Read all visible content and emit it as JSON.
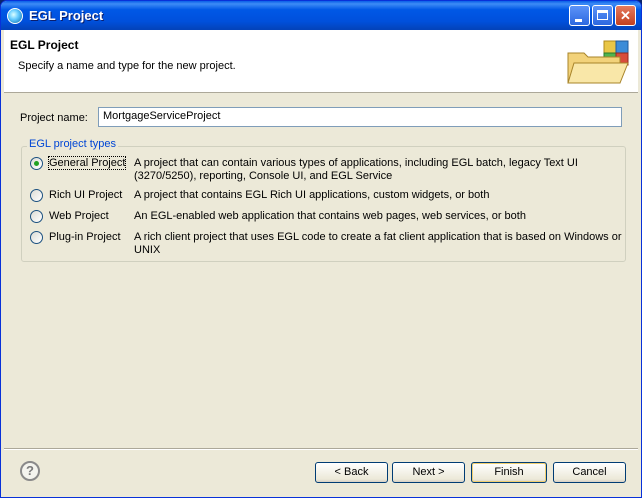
{
  "window": {
    "title": "EGL Project"
  },
  "banner": {
    "heading": "EGL Project",
    "description": "Specify a name and type for the new project."
  },
  "form": {
    "project_name_label": "Project name:",
    "project_name_value": "MortgageServiceProject"
  },
  "project_types": {
    "group_label": "EGL project types",
    "options": [
      {
        "label": "General Project",
        "description": "A project that can contain various types of applications, including EGL batch, legacy Text UI (3270/5250), reporting, Console UI, and EGL Service",
        "selected": true
      },
      {
        "label": "Rich UI Project",
        "description": "A project that contains EGL Rich UI applications, custom widgets, or both",
        "selected": false
      },
      {
        "label": "Web Project",
        "description": "An EGL-enabled web application that contains web pages, web services, or both",
        "selected": false
      },
      {
        "label": "Plug-in Project",
        "description": "A rich client project that uses EGL code to create a fat client application that is based on Windows or UNIX",
        "selected": false
      }
    ]
  },
  "buttons": {
    "back_label": "< Back",
    "next_label": "Next >",
    "finish_label": "Finish",
    "cancel_label": "Cancel"
  },
  "icons": {
    "help": "?",
    "close": "✕"
  }
}
